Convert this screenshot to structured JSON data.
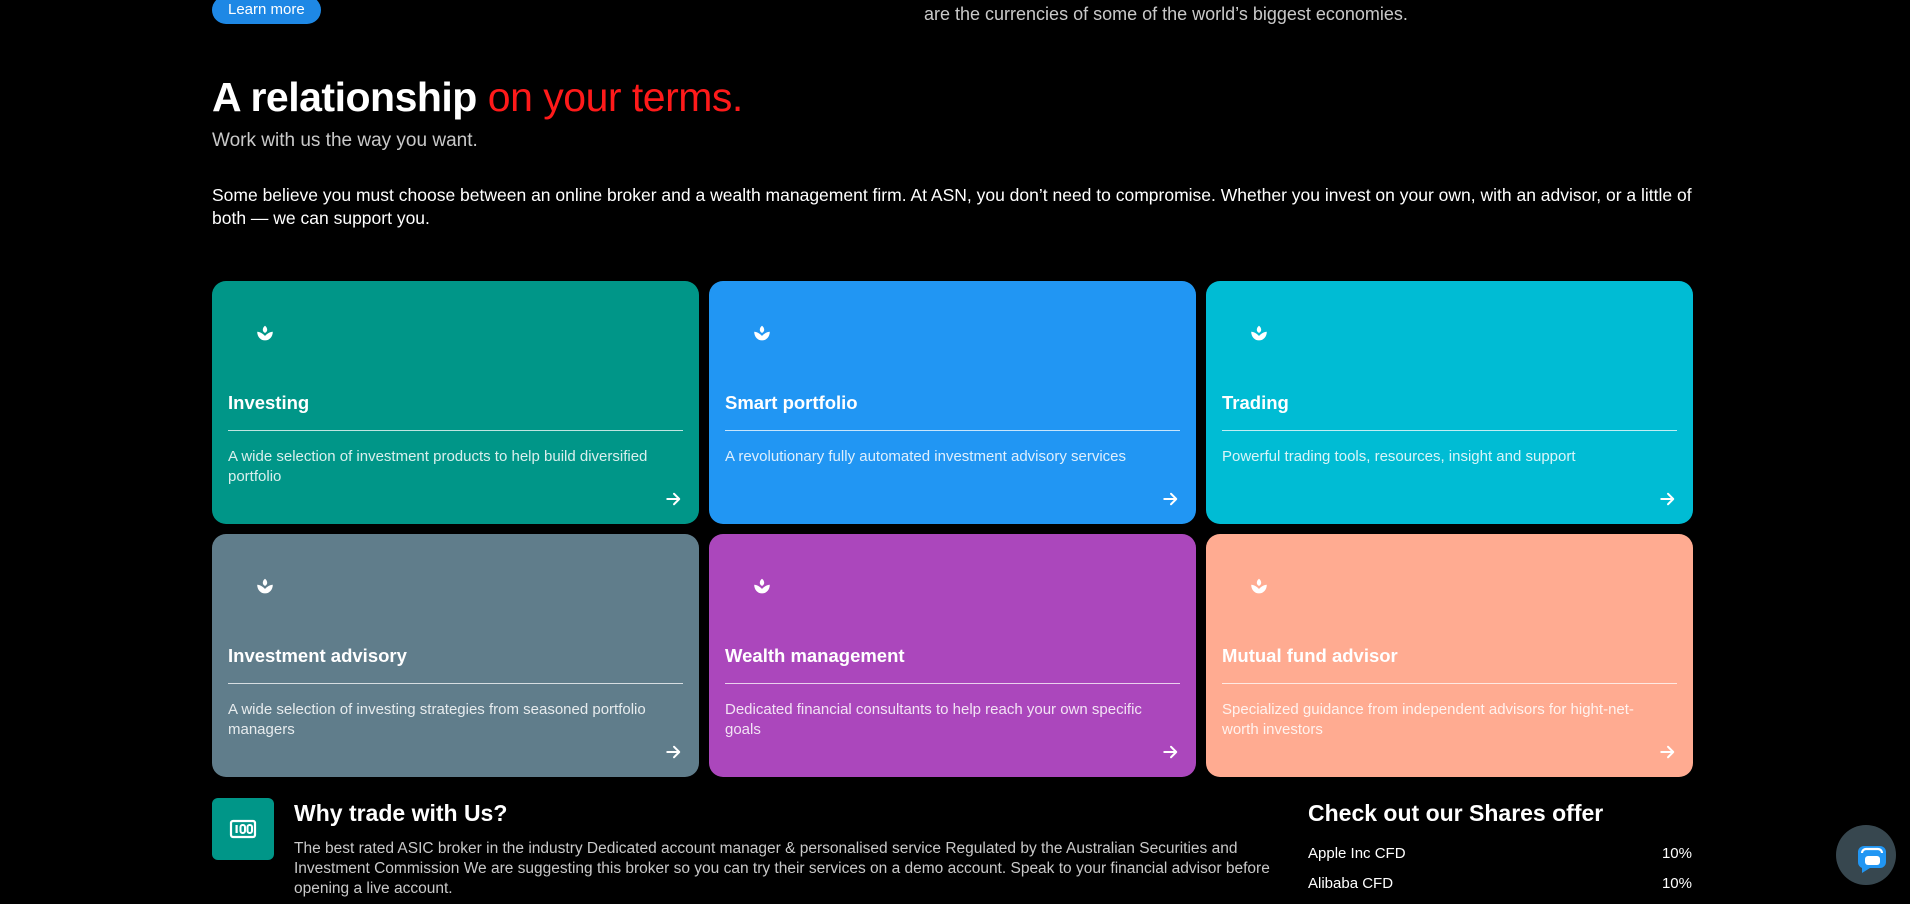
{
  "top": {
    "learn_more": "Learn more",
    "currencies_text": "are the currencies of some of the world’s biggest economies."
  },
  "heading": {
    "title_main": "A relationship",
    "title_accent": "on your terms.",
    "subtitle": "Work with us the way you want.",
    "intro": "Some believe you must choose between an online broker and a wealth management firm. At ASN, you don’t need to compromise. Whether you invest on your own, with an advisor, or a little of both — we can support you."
  },
  "cards": [
    {
      "title": "Investing",
      "description": "A wide selection of investment products to help build diversified portfolio",
      "color": "#009688",
      "icon": "sprout-icon"
    },
    {
      "title": "Smart portfolio",
      "description": "A revolutionary fully automated investment advisory services",
      "color": "#2196f3",
      "icon": "sprout-icon"
    },
    {
      "title": "Trading",
      "description": "Powerful trading tools, resources, insight and support",
      "color": "#00bcd4",
      "icon": "sprout-icon"
    },
    {
      "title": "Investment advisory",
      "description": "A wide selection of investing strategies from seasoned portfolio managers",
      "color": "#607d8b",
      "icon": "sprout-icon"
    },
    {
      "title": "Wealth management",
      "description": "Dedicated financial consultants to help reach your own specific goals",
      "color": "#ab47bc",
      "icon": "sprout-icon"
    },
    {
      "title": "Mutual fund advisor",
      "description": "Specialized guidance from independent advisors for hight-net-worth investors",
      "color": "#ffab91",
      "icon": "sprout-icon"
    }
  ],
  "why": {
    "title": "Why trade with Us?",
    "text": "The best rated ASIC broker in the industry Dedicated account manager & personalised service Regulated by the Australian Securities and Investment Commission We are suggesting this broker so you can try their services on a demo account. Speak to your financial advisor before opening a live account.",
    "icon": "cash-icon",
    "icon_color": "#009688"
  },
  "shares": {
    "title": "Check out our Shares offer",
    "rows": [
      {
        "name": "Apple Inc CFD",
        "value": "10%"
      },
      {
        "name": "Alibaba CFD",
        "value": "10%"
      }
    ]
  },
  "chat": {
    "icon": "chat-icon",
    "color": "#37474f"
  },
  "colors": {
    "accent": "#ff1a1a",
    "button_blue": "#1e88e5"
  }
}
